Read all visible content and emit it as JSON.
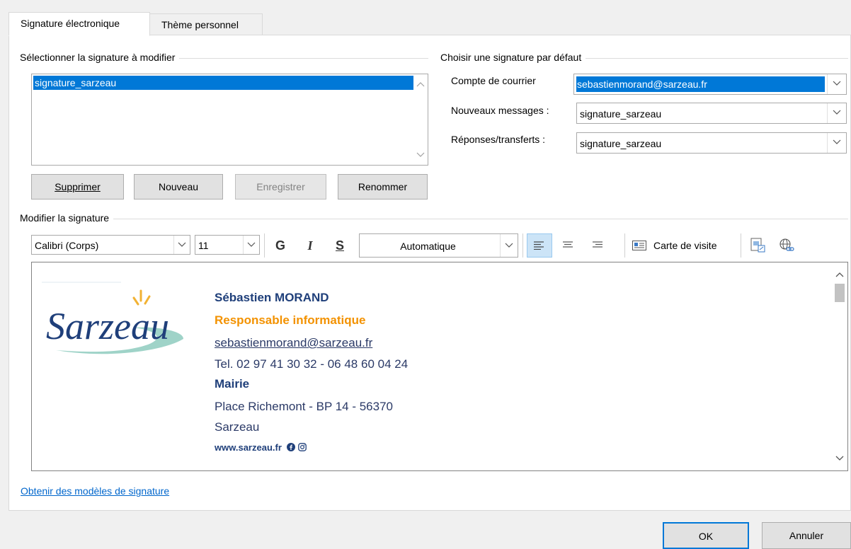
{
  "tabs": [
    {
      "label": "Signature électronique",
      "active": true
    },
    {
      "label": "Thème personnel",
      "active": false
    }
  ],
  "select_group": {
    "title": "Sélectionner la signature à modifier",
    "items": [
      "signature_sarzeau"
    ],
    "selected_index": 0
  },
  "actions": {
    "delete": "Supprimer",
    "new": "Nouveau",
    "save": "Enregistrer",
    "rename": "Renommer"
  },
  "default_group": {
    "title": "Choisir une signature par défaut",
    "account_label": "Compte de courrier",
    "account_value": "sebastienmorand@sarzeau.fr",
    "new_messages_label": "Nouveaux messages :",
    "new_messages_value": "signature_sarzeau",
    "replies_label": "Réponses/transferts :",
    "replies_value": "signature_sarzeau"
  },
  "edit_group": {
    "title": "Modifier la signature"
  },
  "toolbar": {
    "font": "Calibri (Corps)",
    "size": "11",
    "bold": "G",
    "italic": "I",
    "underline": "S",
    "color": "Automatique",
    "business_card": "Carte de visite"
  },
  "signature": {
    "logo_text": "Sarzeau",
    "name": "Sébastien MORAND",
    "role": "Responsable informatique",
    "email": "sebastienmorand@sarzeau.fr",
    "phone": "Tel. 02 97 41 30 32 - 06 48 60 04 24",
    "org": "Mairie",
    "address": "Place Richemont - BP 14 - 56370",
    "city": "Sarzeau",
    "website": "www.sarzeau.fr"
  },
  "templates_link": "Obtenir des modèles de signature",
  "footer": {
    "ok": "OK",
    "cancel": "Annuler"
  },
  "colors": {
    "selection": "#0078d7",
    "name": "#1f3f7a",
    "role": "#f39200",
    "body_text": "#2b3a67",
    "link": "#1a4a9e"
  }
}
